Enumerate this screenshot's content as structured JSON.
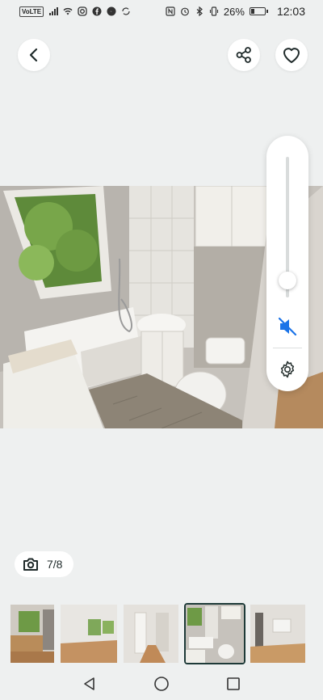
{
  "status_bar": {
    "carrier_badge": "VoLTE",
    "battery_text": "26%",
    "battery_level": 0.26,
    "time": "12:03"
  },
  "header": {
    "back_icon": "chevron-left-icon",
    "share_icon": "share-icon",
    "favorite_icon": "heart-outline-icon"
  },
  "gallery": {
    "counter": "7/8",
    "counter_icon": "camera-icon",
    "current_index": 7,
    "total": 8
  },
  "video_controls": {
    "volume_level": 0.12,
    "mute_icon": "speaker-muted-icon",
    "settings_icon": "gear-icon",
    "accent_color": "#1a73e8"
  },
  "thumbnails": [
    {
      "name": "thumb-kitchen-1",
      "active": false
    },
    {
      "name": "thumb-room-empty",
      "active": false
    },
    {
      "name": "thumb-hallway",
      "active": false
    },
    {
      "name": "thumb-bathroom",
      "active": true
    },
    {
      "name": "thumb-room-window",
      "active": false
    }
  ],
  "nav_bar": {
    "back_icon": "triangle-back-icon",
    "home_icon": "circle-home-icon",
    "recents_icon": "square-recents-icon"
  }
}
